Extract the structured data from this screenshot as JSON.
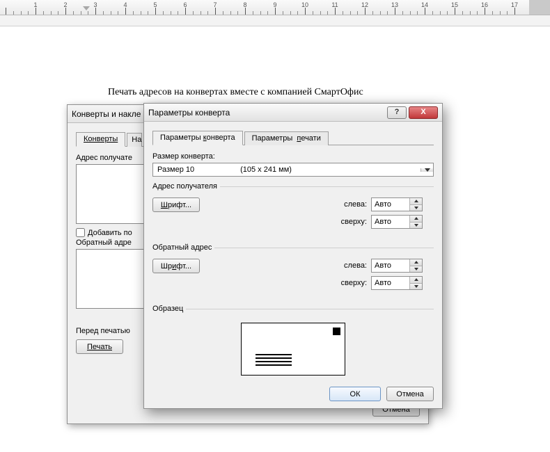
{
  "ruler": {
    "max": 17,
    "dark_after": 17
  },
  "document": {
    "heading": "Печать адресов на конвертах вместе с компанией СмартОфис"
  },
  "back_dialog": {
    "title": "Конверты и накле",
    "tabs": {
      "envelopes": "Конверты",
      "labels_partial": "На"
    },
    "recipient_label": "Адрес получате",
    "add_post_checkbox": "Добавить по",
    "return_label": "Обратный адре",
    "before_print": "Перед печатью",
    "print_btn": "Печать",
    "cancel_btn": "Отмена"
  },
  "front_dialog": {
    "title": "Параметры конверта",
    "tabs": {
      "params": "Параметры конверта",
      "print": "Параметры  печати"
    },
    "size_label": "Размер конверта:",
    "size_value": "Размер 10",
    "size_dims": "(105 x 241 мм)",
    "addr_group": "Адрес получателя",
    "return_group": "Обратный адрес",
    "font_btn": "Шрифт...",
    "left_label": "слева:",
    "top_label": "сверху:",
    "auto": "Авто",
    "sample_label": "Образец",
    "ok_btn": "ОК",
    "cancel_btn": "Отмена"
  }
}
